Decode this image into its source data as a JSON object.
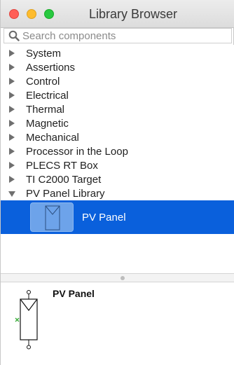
{
  "window": {
    "title": "Library Browser"
  },
  "search": {
    "placeholder": "Search components"
  },
  "tree": {
    "items": [
      {
        "label": "System",
        "expanded": false
      },
      {
        "label": "Assertions",
        "expanded": false
      },
      {
        "label": "Control",
        "expanded": false
      },
      {
        "label": "Electrical",
        "expanded": false
      },
      {
        "label": "Thermal",
        "expanded": false
      },
      {
        "label": "Magnetic",
        "expanded": false
      },
      {
        "label": "Mechanical",
        "expanded": false
      },
      {
        "label": "Processor in the Loop",
        "expanded": false
      },
      {
        "label": "PLECS RT Box",
        "expanded": false
      },
      {
        "label": "TI C2000 Target",
        "expanded": false
      },
      {
        "label": "PV Panel Library",
        "expanded": true
      }
    ],
    "selected_item": {
      "label": "PV Panel",
      "icon": "pv-panel-icon"
    }
  },
  "preview": {
    "title": "PV Panel",
    "icon": "pv-panel-symbol-icon"
  },
  "colors": {
    "selection": "#0a60dc",
    "close": "#ff5f57",
    "minimize": "#febc2e",
    "maximize": "#28c840",
    "port": "#3fae3f"
  }
}
